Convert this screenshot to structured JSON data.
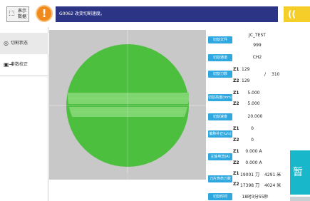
{
  "topbar": {
    "switch_label": "表示\n数据",
    "warning_symbol": "!",
    "alarm_text": "G0062  改变切割速度。",
    "yellow_text": "(("
  },
  "sidebar": {
    "items": [
      {
        "label": "切割状态",
        "icon": "cut-status-icon",
        "active": true
      },
      {
        "label": "参数校正",
        "icon": "calibrate-icon",
        "active": false
      }
    ]
  },
  "plot": {
    "background": "#c8c8c8",
    "wafer_color": "#4cbf3e",
    "cut_band_color": "#7fd56f"
  },
  "panel": {
    "cut_file": {
      "label": "切割文件",
      "line1": "JC_TEST",
      "line2": "999"
    },
    "channel": {
      "label": "切割通道",
      "value": "CH2"
    },
    "cut_count": {
      "label": "切割刀数",
      "z1": "129",
      "z2": "129",
      "sep": "/",
      "total": "310"
    },
    "height": {
      "label": "切割高度(mm)",
      "z1": "5.000",
      "z2": "5.000"
    },
    "speed": {
      "label": "切割速度(mm/s)",
      "value": "20.000"
    },
    "offset": {
      "label": "偏移补正(u/s)",
      "z1": "0",
      "z2": "0"
    },
    "current": {
      "label": "主轴电流(A)",
      "z1": "0.000 A",
      "z2": "0.000 A"
    },
    "blade_life": {
      "label": "刀片寿命刀数",
      "z1": "19001 刀",
      "z1_m": "4291 米",
      "z2": "17398 刀",
      "z2_m": "4024 米"
    },
    "time": {
      "label": "切割时间",
      "value": "18时3分55秒"
    },
    "z1_tag": "Z1",
    "z2_tag": "Z2",
    "label_color": "#2fa8e0"
  },
  "right": {
    "pause_label": "暂"
  }
}
